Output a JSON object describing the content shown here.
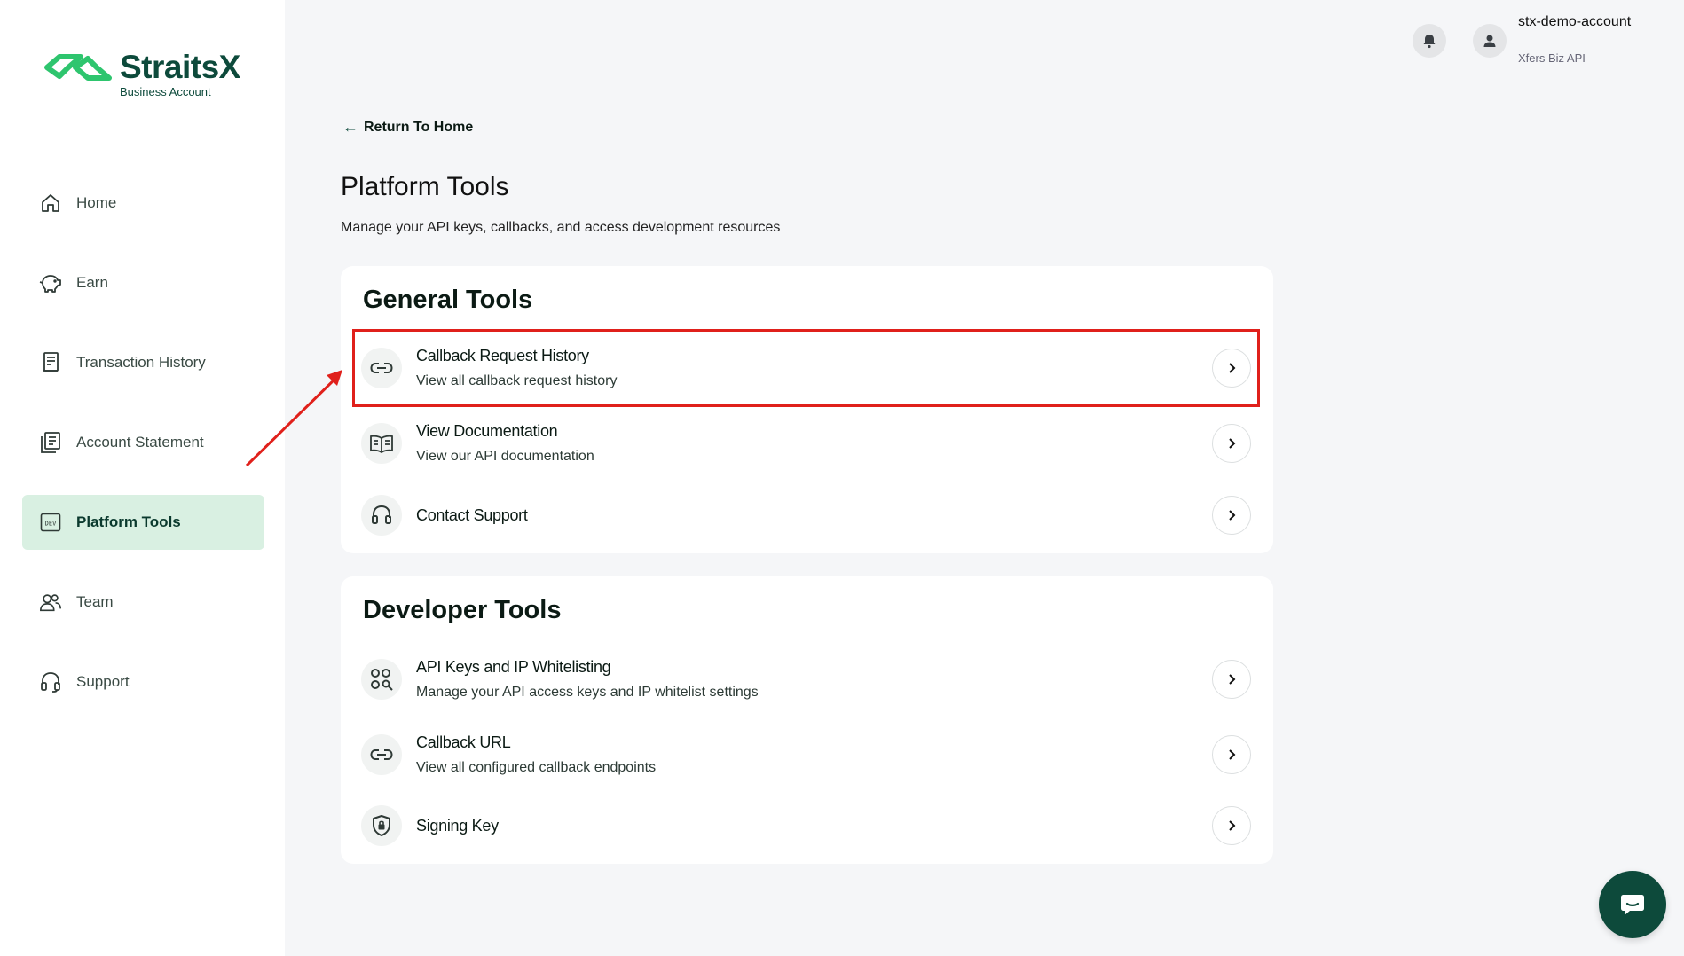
{
  "brand": {
    "name": "StraitsX",
    "subtitle": "Business Account",
    "primary_color": "#0d4a3b",
    "accent_color": "#2ec56e"
  },
  "sidebar": {
    "items": [
      {
        "label": "Home",
        "icon": "home-icon"
      },
      {
        "label": "Earn",
        "icon": "piggy-bank-icon"
      },
      {
        "label": "Transaction History",
        "icon": "receipt-icon"
      },
      {
        "label": "Account Statement",
        "icon": "document-list-icon"
      },
      {
        "label": "Platform Tools",
        "icon": "dev-icon",
        "active": true
      },
      {
        "label": "Team",
        "icon": "team-icon"
      },
      {
        "label": "Support",
        "icon": "headset-icon"
      }
    ]
  },
  "header": {
    "account_name": "stx-demo-account",
    "account_type": "Xfers Biz API"
  },
  "main": {
    "back_label": "Return To Home",
    "title": "Platform Tools",
    "subtitle": "Manage your API keys, callbacks, and access development resources",
    "sections": [
      {
        "title": "General Tools",
        "rows": [
          {
            "title": "Callback Request History",
            "desc": "View all callback request history",
            "icon": "link-icon",
            "highlighted": true
          },
          {
            "title": "View Documentation",
            "desc": "View our API documentation",
            "icon": "book-icon"
          },
          {
            "title": "Contact Support",
            "desc": "",
            "icon": "headset-icon"
          }
        ]
      },
      {
        "title": "Developer Tools",
        "rows": [
          {
            "title": "API Keys and IP Whitelisting",
            "desc": "Manage your API access keys and IP whitelist settings",
            "icon": "key-search-icon"
          },
          {
            "title": "Callback URL",
            "desc": "View all configured callback endpoints",
            "icon": "link-icon"
          },
          {
            "title": "Signing Key",
            "desc": "",
            "icon": "shield-lock-icon"
          }
        ]
      }
    ]
  },
  "annotation": {
    "highlight_color": "#e0201b"
  }
}
